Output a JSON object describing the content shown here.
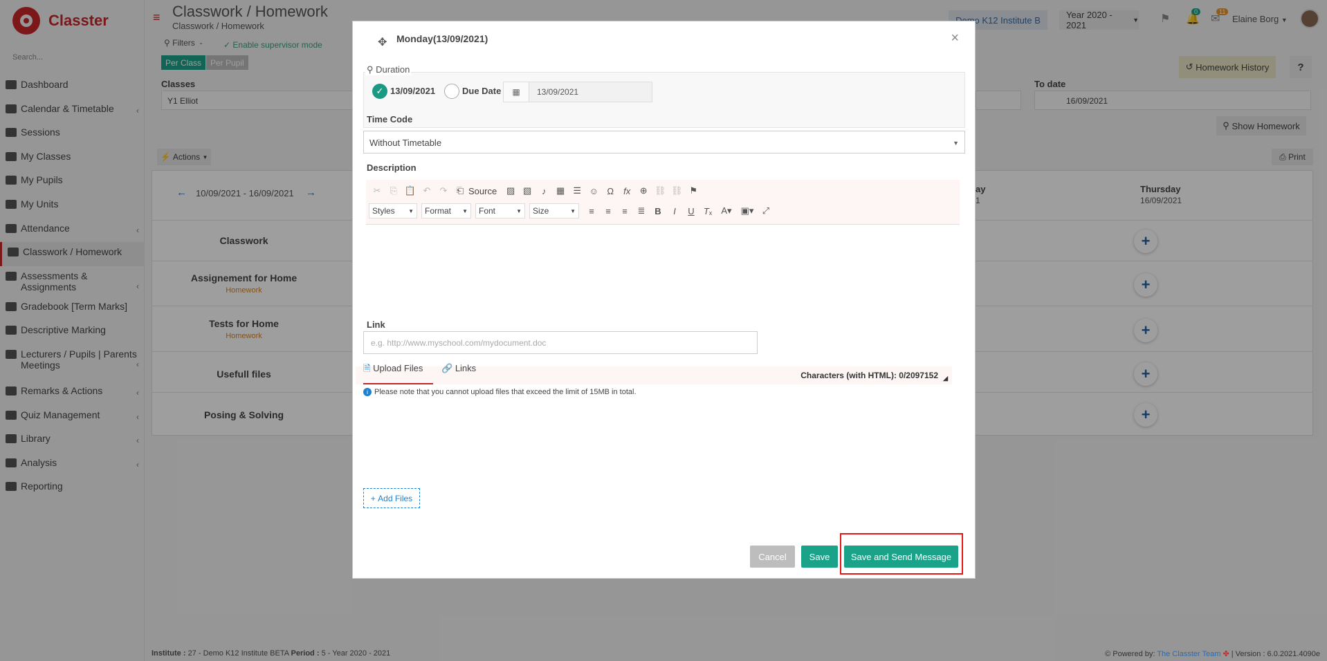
{
  "app": {
    "brand": "Classter",
    "search_placeholder": "Search..."
  },
  "sidebar": {
    "items": [
      {
        "label": "Dashboard",
        "caret": ""
      },
      {
        "label": "Calendar & Timetable",
        "caret": "‹"
      },
      {
        "label": "Sessions",
        "caret": ""
      },
      {
        "label": "My Classes",
        "caret": ""
      },
      {
        "label": "My Pupils",
        "caret": ""
      },
      {
        "label": "My Units",
        "caret": ""
      },
      {
        "label": "Attendance",
        "caret": "‹"
      },
      {
        "label": "Classwork / Homework",
        "caret": ""
      },
      {
        "label": "Assessments & Assignments",
        "caret": "‹"
      },
      {
        "label": "Gradebook [Term Marks]",
        "caret": ""
      },
      {
        "label": "Descriptive Marking",
        "caret": ""
      },
      {
        "label": "Lecturers / Pupils | Parents Meetings",
        "caret": "‹"
      },
      {
        "label": "Remarks & Actions",
        "caret": "‹"
      },
      {
        "label": "Quiz Management",
        "caret": "‹"
      },
      {
        "label": "Library",
        "caret": "‹"
      },
      {
        "label": "Analysis",
        "caret": "‹"
      },
      {
        "label": "Reporting",
        "caret": ""
      }
    ]
  },
  "header": {
    "title": "Classwork / Homework",
    "breadcrumb": "Classwork / Homework",
    "institute": "Demo K12 Institute B",
    "year": "Year 2020 - 2021",
    "notif_count": "0",
    "mail_count": "11",
    "user": "Elaine Borg"
  },
  "page": {
    "filters_label": "Filters",
    "supervisor_label": "Enable supervisor mode",
    "per_class": "Per Class",
    "per_pupil": "Per Pupil",
    "classes_label": "Classes",
    "classes_value": "Y1 Elliot",
    "to_date_label": "To date",
    "to_date_value": "16/09/2021",
    "homework_history": "Homework History",
    "help": "?",
    "show_homework": "Show Homework",
    "actions": "Actions",
    "print": "Print",
    "week_range": "10/09/2021 - 16/09/2021",
    "day_partial": "ay",
    "day_partial_date": "1",
    "day_last": "Thursday",
    "day_last_date": "16/09/2021",
    "rows": [
      {
        "label": "Classwork",
        "sub": ""
      },
      {
        "label": "Assignement for Home",
        "sub": "Homework"
      },
      {
        "label": "Tests for Home",
        "sub": "Homework"
      },
      {
        "label": "Usefull files",
        "sub": ""
      },
      {
        "label": "Posing & Solving",
        "sub": ""
      }
    ]
  },
  "modal": {
    "title": "Monday(13/09/2021)",
    "duration_label": "Duration",
    "option_date": "13/09/2021",
    "option_due": "Due Date",
    "date_value": "13/09/2021",
    "time_code_label": "Time Code",
    "time_code_value": "Without Timetable",
    "description_label": "Description",
    "toolbar": {
      "source": "Source",
      "styles": "Styles",
      "format": "Format",
      "font": "Font",
      "size": "Size"
    },
    "char_count": "Characters (with HTML): 0/2097152",
    "link_label": "Link",
    "link_placeholder": "e.g. http://www.myschool.com/mydocument.doc",
    "tab_upload": "Upload Files",
    "tab_links": "Links",
    "upload_note": "Please note that you cannot upload files that exceed the limit of 15MB in total.",
    "add_files": "Add Files",
    "cancel": "Cancel",
    "save": "Save",
    "save_send": "Save and Send Message"
  },
  "footer": {
    "institute_label": "Institute :",
    "institute_value": "27 - Demo K12 Institute BETA",
    "period_label": "Period :",
    "period_value": "5 - Year 2020 - 2021",
    "powered_label": "Powered by:",
    "powered_link": "The Classter Team",
    "version": "| Version : 6.0.2021.4090e"
  },
  "colors": {
    "brand": "#c9262b",
    "accent": "#1aa389",
    "link": "#1f80d0",
    "highlight": "#e61717"
  }
}
